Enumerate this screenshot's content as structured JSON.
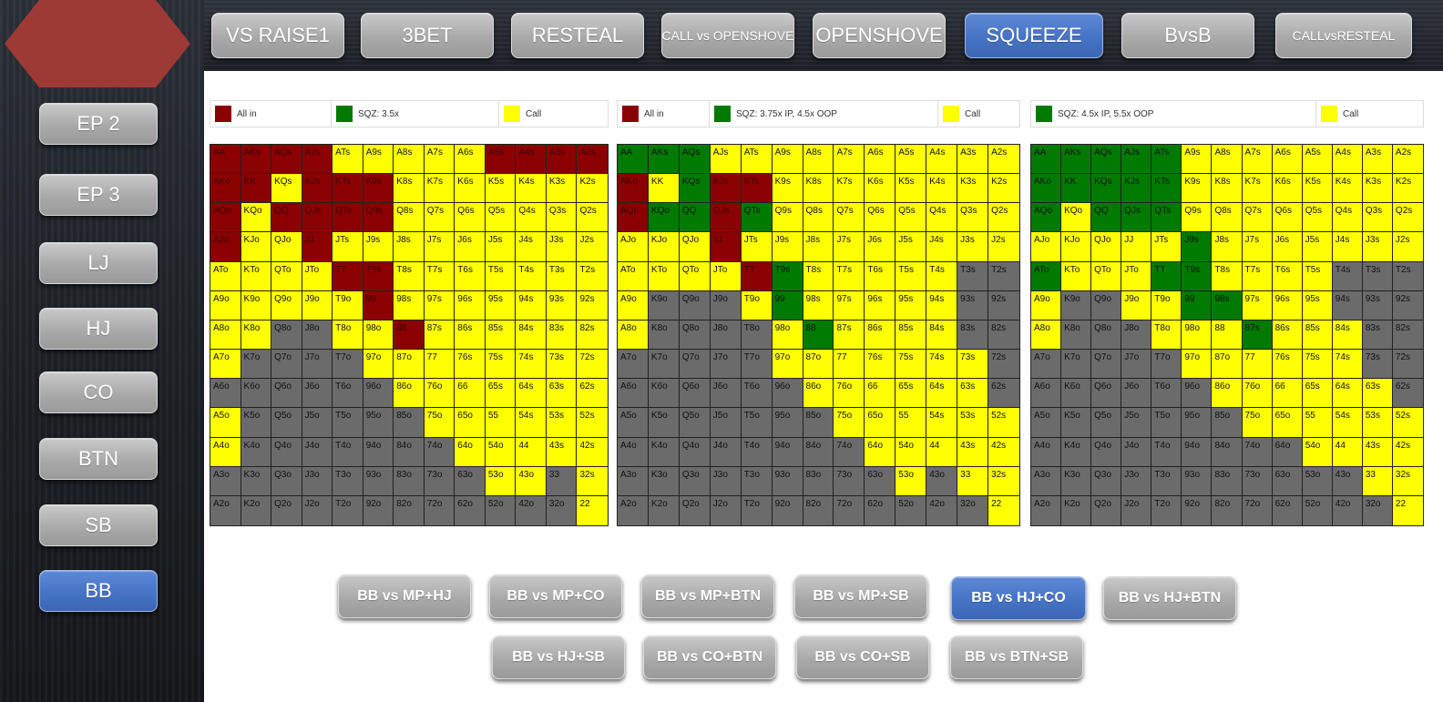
{
  "colors": {
    "allin": "#8b0000",
    "sqz": "#007a00",
    "call": "#ffff00",
    "fold": "#6b6b6b",
    "active_button": "#4472c4",
    "button": "#a6a6a6",
    "logo": "#9e3a35"
  },
  "logo_icon": "pentagon-logo-icon",
  "top_tabs": [
    "VS RAISE1",
    "3BET",
    "RESTEAL",
    "CALL vs OPENSHOVE",
    "OPENSHOVE",
    "SQUEEZE",
    "BvsB",
    "CALLvsRESTEAL"
  ],
  "active_top_tab": "SQUEEZE",
  "positions": [
    "EP 2",
    "EP 3",
    "LJ",
    "HJ",
    "CO",
    "BTN",
    "SB",
    "BB"
  ],
  "active_position": "BB",
  "scenarios_row1": [
    "BB vs MP+HJ",
    "BB vs MP+CO",
    "BB vs MP+BTN",
    "BB vs MP+SB",
    "BB vs HJ+CO",
    "BB vs HJ+BTN"
  ],
  "scenarios_row2": [
    "BB vs HJ+SB",
    "BB vs CO+BTN",
    "BB vs CO+SB",
    "BB vs BTN+SB"
  ],
  "active_scenario": "BB vs HJ+CO",
  "hand_rows": [
    [
      "AA",
      "AKs",
      "AQs",
      "AJs",
      "ATs",
      "A9s",
      "A8s",
      "A7s",
      "A6s",
      "A5s",
      "A4s",
      "A3s",
      "A2s"
    ],
    [
      "AKo",
      "KK",
      "KQs",
      "KJs",
      "KTs",
      "K9s",
      "K8s",
      "K7s",
      "K6s",
      "K5s",
      "K4s",
      "K3s",
      "K2s"
    ],
    [
      "AQo",
      "KQo",
      "QQ",
      "QJs",
      "QTs",
      "Q9s",
      "Q8s",
      "Q7s",
      "Q6s",
      "Q5s",
      "Q4s",
      "Q3s",
      "Q2s"
    ],
    [
      "AJo",
      "KJo",
      "QJo",
      "JJ",
      "JTs",
      "J9s",
      "J8s",
      "J7s",
      "J6s",
      "J5s",
      "J4s",
      "J3s",
      "J2s"
    ],
    [
      "ATo",
      "KTo",
      "QTo",
      "JTo",
      "TT",
      "T9s",
      "T8s",
      "T7s",
      "T6s",
      "T5s",
      "T4s",
      "T3s",
      "T2s"
    ],
    [
      "A9o",
      "K9o",
      "Q9o",
      "J9o",
      "T9o",
      "99",
      "98s",
      "97s",
      "96s",
      "95s",
      "94s",
      "93s",
      "92s"
    ],
    [
      "A8o",
      "K8o",
      "Q8o",
      "J8o",
      "T8o",
      "98o",
      "88",
      "87s",
      "86s",
      "85s",
      "84s",
      "83s",
      "82s"
    ],
    [
      "A7o",
      "K7o",
      "Q7o",
      "J7o",
      "T7o",
      "97o",
      "87o",
      "77",
      "76s",
      "75s",
      "74s",
      "73s",
      "72s"
    ],
    [
      "A6o",
      "K6o",
      "Q6o",
      "J6o",
      "T6o",
      "96o",
      "86o",
      "76o",
      "66",
      "65s",
      "64s",
      "63s",
      "62s"
    ],
    [
      "A5o",
      "K5o",
      "Q5o",
      "J5o",
      "T5o",
      "95o",
      "85o",
      "75o",
      "65o",
      "55",
      "54s",
      "53s",
      "52s"
    ],
    [
      "A4o",
      "K4o",
      "Q4o",
      "J4o",
      "T4o",
      "94o",
      "84o",
      "74o",
      "64o",
      "54o",
      "44",
      "43s",
      "42s"
    ],
    [
      "A3o",
      "K3o",
      "Q3o",
      "J3o",
      "T3o",
      "93o",
      "83o",
      "73o",
      "63o",
      "53o",
      "43o",
      "33",
      "32s"
    ],
    [
      "A2o",
      "K2o",
      "Q2o",
      "J2o",
      "T2o",
      "92o",
      "82o",
      "72o",
      "62o",
      "52o",
      "42o",
      "32o",
      "22"
    ]
  ],
  "charts": [
    {
      "legend": [
        {
          "label": "All in",
          "color": "#8b0000"
        },
        {
          "label": "SQZ: 3.5x",
          "color": "#007a00"
        },
        {
          "label": "Call",
          "color": "#ffff00"
        }
      ],
      "actions": [
        "AAAAYYYYYAAAA",
        "AAYAAAYYYYYYY",
        "AYAAAAYYYYYYY",
        "AYYAYYYYYYYYY",
        "YYYYAAYYYYYYY",
        "YYYYYAYYYYYYY",
        "YYFFYYAYYYYYY",
        "YFFFFYYYYYYYY",
        "FFFFFFYYYYYYY",
        "YFFFFFFYYYYYY",
        "YFFFFFFFYYYYY",
        "FFFFFFFFFYYFY",
        "FFFFFFFFFFFFY"
      ]
    },
    {
      "legend": [
        {
          "label": "All in",
          "color": "#8b0000"
        },
        {
          "label": "SQZ: 3.75x IP, 4.5x OOP",
          "color": "#007a00"
        },
        {
          "label": "Call",
          "color": "#ffff00"
        }
      ],
      "actions": [
        "SSSYYYYYYYYYY",
        "AYSAAYYYYYYYY",
        "ASSASYYYYYYYY",
        "YYYAYYYYYYYYY",
        "YYYYASYYYYYFF",
        "YFFFYSYYYYYFF",
        "YFFFFYSYYYYFF",
        "FFFFFYYYYYYYF",
        "FFFFFFYYYYYYF",
        "FFFFFFFYYYYYY",
        "FFFFFFFFYYYYY",
        "FFFFFFFFFYFYY",
        "FFFFFFFFFFFFY"
      ]
    },
    {
      "legend": [
        {
          "label": "SQZ: 4.5x IP, 5.5x OOP",
          "color": "#007a00"
        },
        {
          "label": "Call",
          "color": "#ffff00"
        }
      ],
      "actions": [
        "SSSSSYYYYYYYY",
        "SSSSSYYYYYYYY",
        "SYSSSYYYYYYYY",
        "YYYYYSYYYYYYY",
        "SYYYSSYYYYFFF",
        "YFFYYSSYYYFFF",
        "YFFFYYYSYYYFF",
        "FFFFFYYYYYYFF",
        "FFFFFFYYYYYYF",
        "FFFFFFFYYYYYY",
        "FFFFFFFFFYYYY",
        "FFFFFFFFFFFYY",
        "FFFFFFFFFFFFY"
      ]
    }
  ]
}
